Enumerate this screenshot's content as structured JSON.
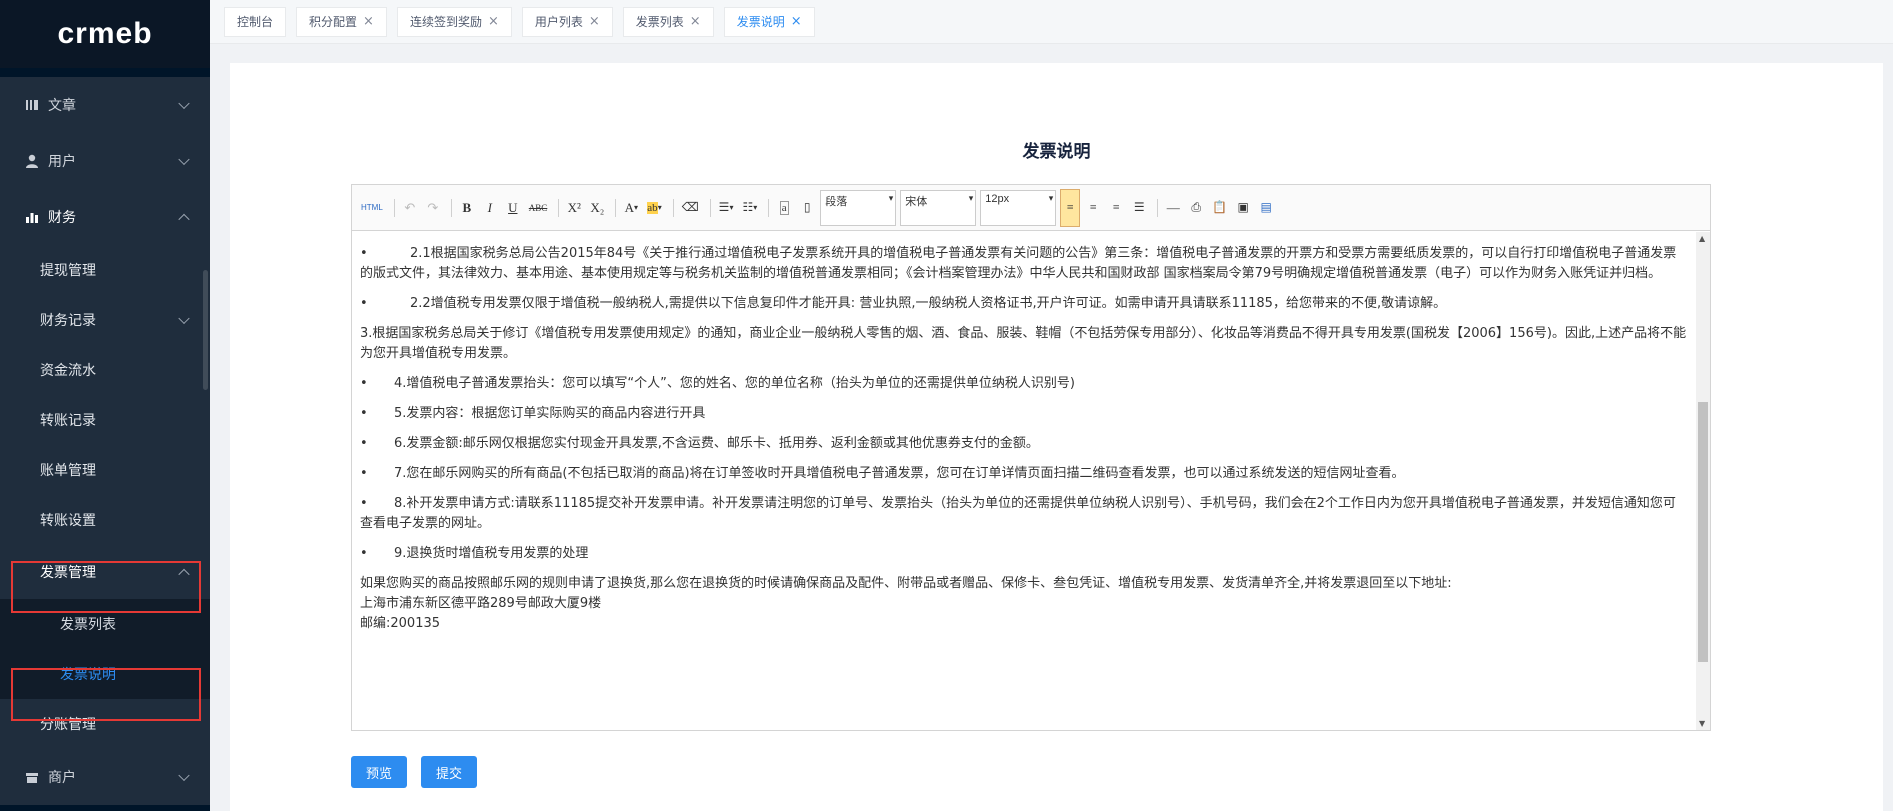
{
  "app": {
    "logo": "crmeb"
  },
  "sidebar": {
    "l1": {
      "article": "文章",
      "user": "用户",
      "finance": "财务",
      "merchant": "商户"
    },
    "finance_items": [
      "提现管理",
      "财务记录",
      "资金流水",
      "转账记录",
      "账单管理",
      "转账设置"
    ],
    "invoice_mgmt": "发票管理",
    "invoice_children": [
      "发票列表",
      "发票说明"
    ],
    "split_mgmt": "分账管理"
  },
  "tabs": [
    {
      "label": "控制台",
      "closable": false
    },
    {
      "label": "积分配置",
      "closable": true
    },
    {
      "label": "连续签到奖励",
      "closable": true
    },
    {
      "label": "用户列表",
      "closable": true
    },
    {
      "label": "发票列表",
      "closable": true
    },
    {
      "label": "发票说明",
      "closable": true,
      "active": true
    }
  ],
  "tab_close_glyph": "×",
  "page": {
    "title": "发票说明"
  },
  "editor": {
    "toolbar": {
      "html": "HTML",
      "bold": "B",
      "italic": "I",
      "underline": "U",
      "strike": "ABC",
      "sup": "X²",
      "sub": "X₂",
      "fontcolor": "A",
      "paragraph": "段落",
      "font": "宋体",
      "size": "12px"
    },
    "paragraphs": [
      {
        "bullet": true,
        "text": "2.1根据国家税务总局公告2015年84号《关于推行通过增值税电子发票系统开具的增值税电子普通发票有关问题的公告》第三条：增值税电子普通发票的开票方和受票方需要纸质发票的，可以自行打印增值税电子普通发票的版式文件，其法律效力、基本用途、基本使用规定等与税务机关监制的增值税普通发票相同；《会计档案管理办法》中华人民共和国财政部 国家档案局令第79号明确规定增值税普通发票（电子）可以作为财务入账凭证并归档。"
      },
      {
        "bullet": true,
        "text": "2.2增值税专用发票仅限于增值税一般纳税人,需提供以下信息复印件才能开具: 营业执照,一般纳税人资格证书,开户许可证。如需申请开具请联系11185，给您带来的不便,敬请谅解。"
      },
      {
        "bullet": false,
        "text": "3.根据国家税务总局关于修订《增值税专用发票使用规定》的通知，商业企业一般纳税人零售的烟、酒、食品、服装、鞋帽（不包括劳保专用部分）、化妆品等消费品不得开具专用发票(国税发【2006】156号)。因此,上述产品将不能为您开具增值税专用发票。"
      },
      {
        "bullet": true,
        "text": "4.增值税电子普通发票抬头：您可以填写“个人”、您的姓名、您的单位名称（抬头为单位的还需提供单位纳税人识别号)"
      },
      {
        "bullet": true,
        "text": "5.发票内容：根据您订单实际购买的商品内容进行开具"
      },
      {
        "bullet": true,
        "text": "6.发票金额:邮乐网仅根据您实付现金开具发票,不含运费、邮乐卡、抵用券、返利金额或其他优惠券支付的金额。"
      },
      {
        "bullet": true,
        "text": "7.您在邮乐网购买的所有商品(不包括已取消的商品)将在订单签收时开具增值税电子普通发票，您可在订单详情页面扫描二维码查看发票，也可以通过系统发送的短信网址查看。"
      },
      {
        "bullet": true,
        "text": "8.补开发票申请方式:请联系11185提交补开发票申请。补开发票请注明您的订单号、发票抬头（抬头为单位的还需提供单位纳税人识别号）、手机号码，我们会在2个工作日内为您开具增值税电子普通发票，并发短信通知您可查看电子发票的网址。"
      },
      {
        "bullet": true,
        "text": "9.退换货时增值税专用发票的处理"
      }
    ],
    "closing": {
      "line1": "如果您购买的商品按照邮乐网的规则申请了退换货,那么您在退换货的时候请确保商品及配件、附带品或者赠品、保修卡、叁包凭证、增值税专用发票、发货清单齐全,并将发票退回至以下地址:",
      "line2": "上海市浦东新区德平路289号邮政大厦9楼",
      "line3": "邮编:200135"
    }
  },
  "buttons": {
    "preview": "预览",
    "submit": "提交"
  },
  "colors": {
    "accent": "#2d8cf0",
    "sidebar_bg": "#001529",
    "highlight": "#e53935"
  }
}
